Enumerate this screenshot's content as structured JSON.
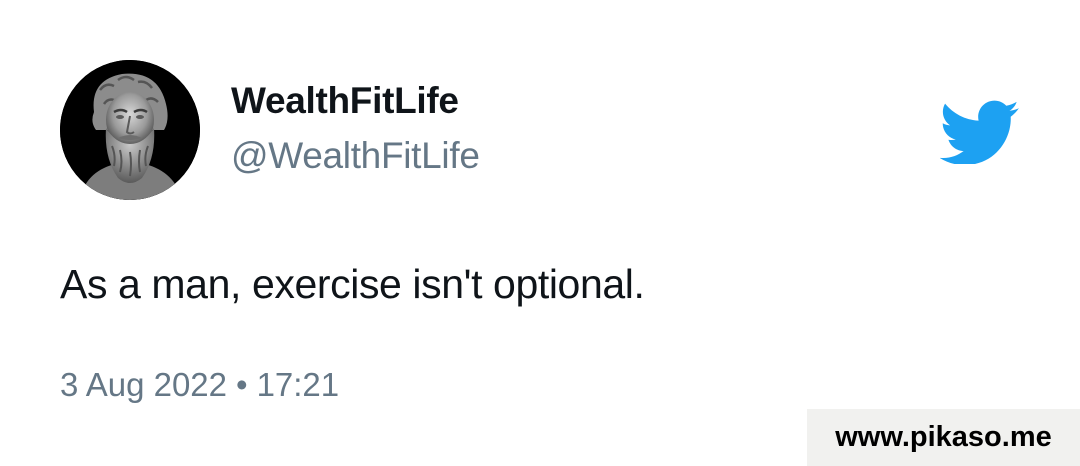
{
  "author": {
    "display_name": "WealthFitLife",
    "handle": "@WealthFitLife",
    "avatar": "plato-bust-avatar"
  },
  "tweet": {
    "text": "As a man, exercise isn't optional.",
    "date": "3 Aug 2022",
    "separator": "•",
    "time": "17:21"
  },
  "brand_icon": "twitter-bird-icon",
  "watermark": {
    "text": "www.pikaso.me"
  },
  "colors": {
    "twitter_blue": "#1da1f2",
    "secondary_text": "#657786",
    "primary_text": "#0f1419",
    "watermark_bg": "#f1f1ef"
  }
}
